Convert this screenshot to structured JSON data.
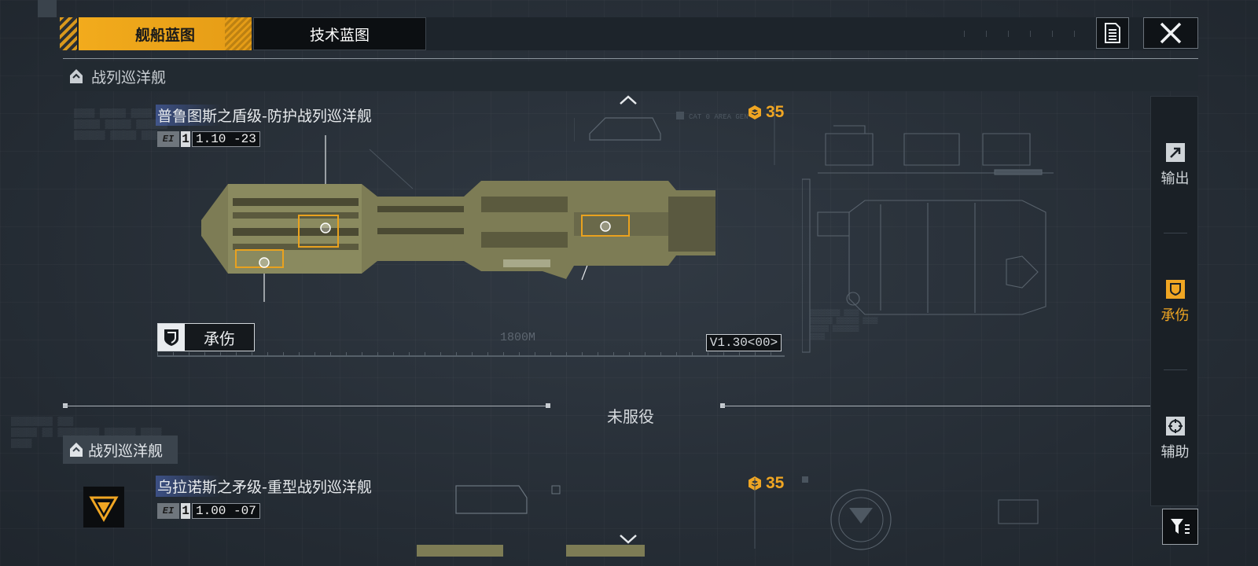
{
  "tabs": {
    "ship_blueprint": "舰船蓝图",
    "tech_blueprint": "技术蓝图"
  },
  "sections": [
    {
      "category": "战列巡洋舰",
      "ship_name": "普鲁图斯之盾级-防护战列巡洋舰",
      "version_digit": "1",
      "version_num": "1.10 -23",
      "cost": "35",
      "role_label": "承伤",
      "length_label": "1800M",
      "version_tag": "V1.30<00>"
    },
    {
      "category": "战列巡洋舰",
      "ship_name": "乌拉诺斯之矛级-重型战列巡洋舰",
      "version_digit": "1",
      "version_num": "1.00 -07",
      "cost": "35"
    }
  ],
  "status_divider": "未服役",
  "right_panel": [
    {
      "label": "输出",
      "icon": "arrow-out-icon"
    },
    {
      "label": "承伤",
      "icon": "shield-icon",
      "active": true
    },
    {
      "label": "辅助",
      "icon": "support-target-icon"
    }
  ],
  "colors": {
    "accent": "#f0a623",
    "background": "#2a323b",
    "panel": "#1a2026"
  }
}
